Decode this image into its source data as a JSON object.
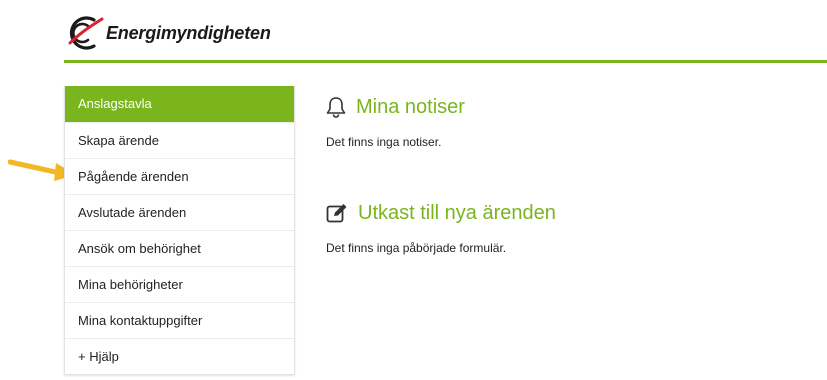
{
  "header": {
    "logo_text": "Energimyndigheten",
    "accent_color": "#7ab51d",
    "logo_red": "#d9232e"
  },
  "sidebar": {
    "items": [
      {
        "label": "Anslagstavla",
        "active": true
      },
      {
        "label": "Skapa ärende",
        "active": false
      },
      {
        "label": "Pågående ärenden",
        "active": false
      },
      {
        "label": "Avslutade ärenden",
        "active": false
      },
      {
        "label": "Ansök om behörighet",
        "active": false
      },
      {
        "label": "Mina behörigheter",
        "active": false
      },
      {
        "label": "Mina kontaktuppgifter",
        "active": false
      },
      {
        "label": "+ Hjälp",
        "active": false
      }
    ]
  },
  "main": {
    "notices": {
      "title": "Mina notiser",
      "icon": "bell-icon",
      "text": "Det finns inga notiser."
    },
    "drafts": {
      "title": "Utkast till nya ärenden",
      "icon": "edit-icon",
      "text": "Det finns inga påbörjade formulär."
    }
  },
  "annotation": {
    "icon": "arrow-icon",
    "color": "#f2b824"
  }
}
